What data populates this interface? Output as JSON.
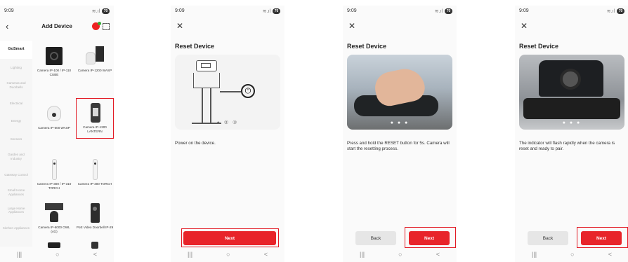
{
  "status": {
    "time": "9:09",
    "signal": "≋.ıl",
    "battery": "70",
    "notif_icons": "✕ 🖾"
  },
  "nav": {
    "recent": "|||",
    "home": "○",
    "back": "<"
  },
  "screen1": {
    "title": "Add Device",
    "sidebar": [
      "GoSmart",
      "Lighting",
      "Cameras and Doorbells",
      "Electrical",
      "Energy",
      "Sensors",
      "Garden and Industry",
      "Gateway Control",
      "Small Home Appliances",
      "Large Home Appliances",
      "Kitchen Appliances"
    ],
    "devices": [
      "Camera IP-100 / IP-110 CUBE",
      "Camera IP-1200 WASP",
      "Camera IP-600 WASP",
      "Camera IP-1300 LANTERN",
      "Camera IP-300 / IP-310 TORCH",
      "Camera IP-300 TORCH",
      "Camera IP-6000 OWL (4G)",
      "PoE Video Doorbell IP-29"
    ]
  },
  "screen2": {
    "title": "Reset Device",
    "dots": "● ② ③",
    "plug_glyph": "⏻",
    "instruction": "Power on the device.",
    "next": "Next"
  },
  "screen3": {
    "title": "Reset Device",
    "dots": "● ● ●",
    "instruction": "Press and hold the RESET button for 5s. Camera will start the resetting process.",
    "back": "Back",
    "next": "Next"
  },
  "screen4": {
    "title": "Reset Device",
    "dots": "● ● ●",
    "instruction": "The indicator will flash rapidly when the camera is reset and ready to pair.",
    "back": "Back",
    "next": "Next"
  },
  "colors": {
    "accent": "#e8242a",
    "highlight": "#e21a24"
  }
}
